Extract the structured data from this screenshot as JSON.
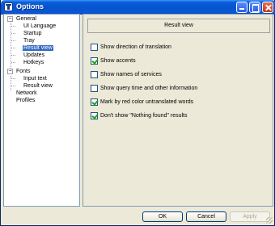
{
  "window": {
    "title": "Options"
  },
  "tree": {
    "nodes": [
      {
        "label": "General",
        "level": 0,
        "expanded": true
      },
      {
        "label": "UI Language",
        "level": 1
      },
      {
        "label": "Startup",
        "level": 1
      },
      {
        "label": "Tray",
        "level": 1
      },
      {
        "label": "Result view",
        "level": 1,
        "selected": true
      },
      {
        "label": "Updates",
        "level": 1
      },
      {
        "label": "Hotkeys",
        "level": 1
      },
      {
        "label": "Fonts",
        "level": 0,
        "expanded": true
      },
      {
        "label": "Input text",
        "level": 1
      },
      {
        "label": "Result view",
        "level": 1
      },
      {
        "label": "Network",
        "level": 0
      },
      {
        "label": "Profiles",
        "level": 0
      }
    ],
    "selected_color": "#316ac5"
  },
  "panel": {
    "header": "Result view",
    "options": [
      {
        "label": "Show direction of translation",
        "checked": false
      },
      {
        "label": "Show accents",
        "checked": true
      },
      {
        "label": "Show names of services",
        "checked": false
      },
      {
        "label": "Show query time and other information",
        "checked": false
      },
      {
        "label": "Mark by red color untranslated words",
        "checked": true
      },
      {
        "label": "Don't show \"Nothing found\" results",
        "checked": true
      }
    ]
  },
  "buttons": {
    "ok": "OK",
    "cancel": "Cancel",
    "apply": "Apply",
    "apply_enabled": false
  }
}
